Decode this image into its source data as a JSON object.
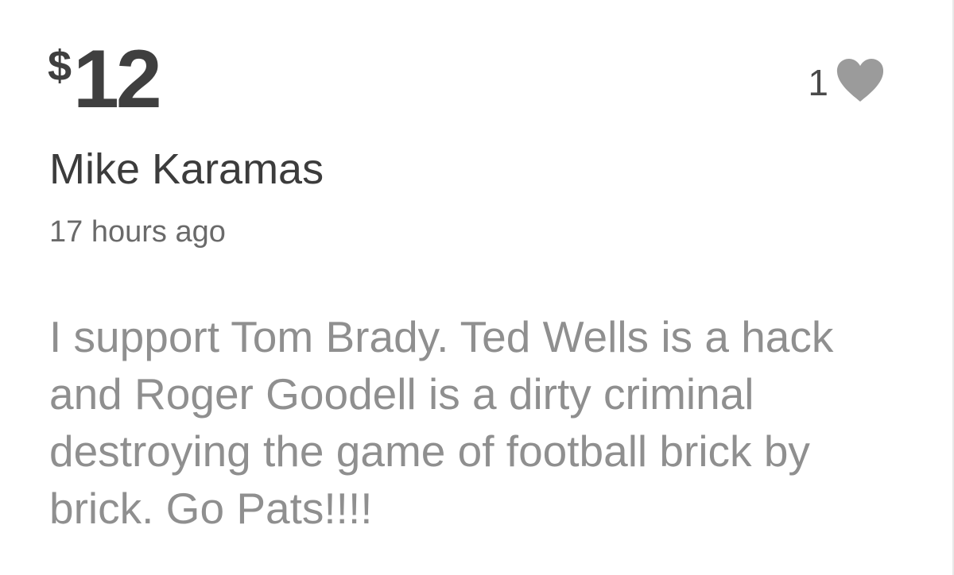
{
  "donation": {
    "currency_symbol": "$",
    "amount": "12",
    "donor_name": "Mike Karamas",
    "time_ago": "17 hours ago",
    "comment": "I support Tom Brady. Ted Wells is a hack and Roger Goodell is a dirty criminal destroying the game of football brick by brick. Go Pats!!!!",
    "likes": {
      "count": "1",
      "icon": "heart-icon",
      "color": "#9b9b9b"
    }
  }
}
